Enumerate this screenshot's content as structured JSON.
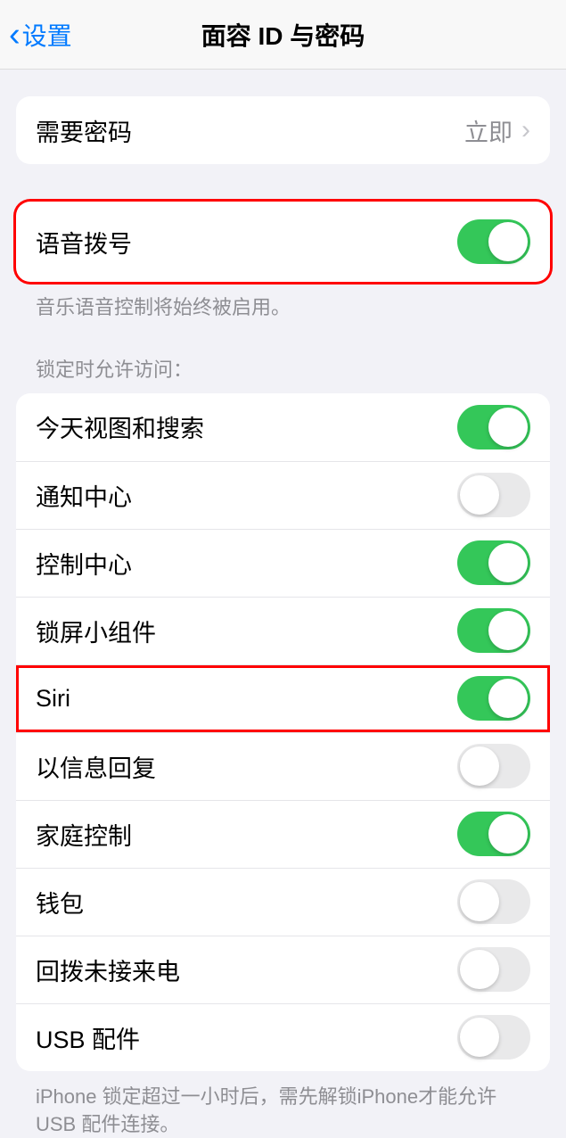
{
  "nav": {
    "back": "设置",
    "title": "面容 ID 与密码"
  },
  "require_passcode": {
    "label": "需要密码",
    "value": "立即"
  },
  "voice_dial": {
    "label": "语音拨号",
    "footer": "音乐语音控制将始终被启用。"
  },
  "locked_access": {
    "header": "锁定时允许访问：",
    "items": [
      {
        "label": "今天视图和搜索",
        "on": true
      },
      {
        "label": "通知中心",
        "on": false
      },
      {
        "label": "控制中心",
        "on": true
      },
      {
        "label": "锁屏小组件",
        "on": true
      },
      {
        "label": "Siri",
        "on": true
      },
      {
        "label": "以信息回复",
        "on": false
      },
      {
        "label": "家庭控制",
        "on": true
      },
      {
        "label": "钱包",
        "on": false
      },
      {
        "label": "回拨未接来电",
        "on": false
      },
      {
        "label": "USB 配件",
        "on": false
      }
    ],
    "footer": "iPhone 锁定超过一小时后，需先解锁iPhone才能允许 USB 配件连接。"
  },
  "highlighted_indices": [
    4
  ]
}
